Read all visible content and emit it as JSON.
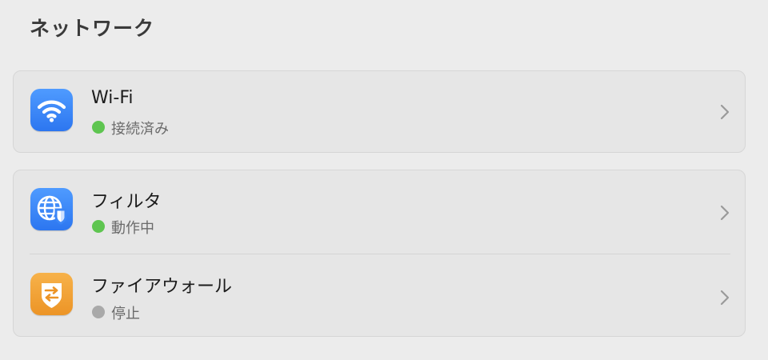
{
  "page": {
    "title": "ネットワーク"
  },
  "wifi": {
    "label": "Wi-Fi",
    "status": "接続済み",
    "status_color": "#5ec550",
    "icon": "wifi-icon",
    "icon_color": "#3b86f7"
  },
  "filter": {
    "label": "フィルタ",
    "status": "動作中",
    "status_color": "#5ec550",
    "icon": "globe-shield-icon",
    "icon_color": "#3b86f7"
  },
  "firewall": {
    "label": "ファイアウォール",
    "status": "停止",
    "status_color": "#a9a9a9",
    "icon": "shield-arrows-icon",
    "icon_color": "#f0a33a"
  }
}
